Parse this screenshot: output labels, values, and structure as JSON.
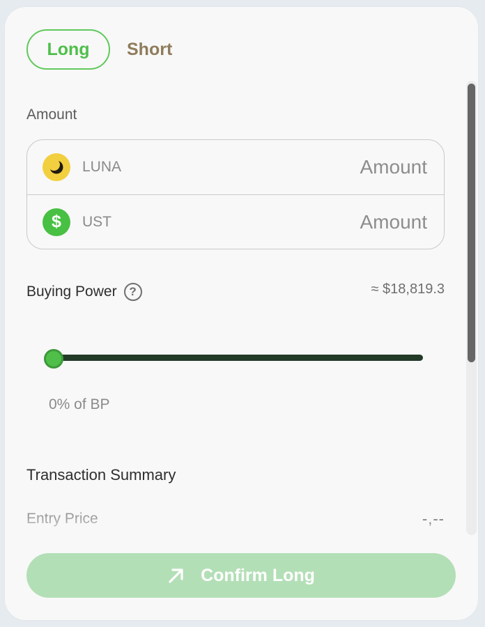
{
  "tabs": {
    "long": "Long",
    "short": "Short",
    "active": "Long"
  },
  "amount": {
    "label": "Amount",
    "rows": [
      {
        "token": "LUNA",
        "icon": "luna-icon",
        "placeholder": "Amount",
        "value": ""
      },
      {
        "token": "UST",
        "icon": "ust-dollar-icon",
        "placeholder": "Amount",
        "value": ""
      }
    ]
  },
  "buying_power": {
    "label": "Buying Power",
    "help_icon": "question-icon",
    "value": "≈ $18,819.3",
    "percent": 0,
    "percent_label": "0% of BP"
  },
  "summary": {
    "title": "Transaction Summary",
    "entry_price_label": "Entry Price",
    "entry_price_value": "-,--"
  },
  "confirm": {
    "label": "Confirm Long",
    "icon": "arrow-up-right-icon"
  },
  "colors": {
    "accent_green": "#4fbf4a",
    "short_text": "#8f7c5b",
    "slider_track": "#233a28",
    "confirm_bg": "#b3dfb6"
  }
}
